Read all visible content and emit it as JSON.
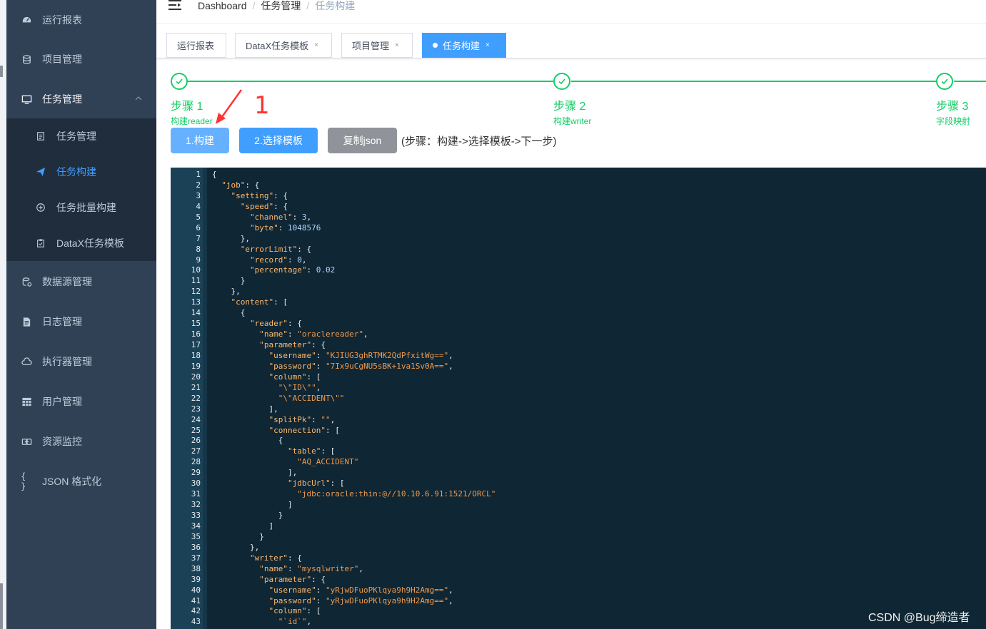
{
  "sidebar": {
    "items": [
      {
        "label": "运行报表",
        "icon": "dashboard-icon"
      },
      {
        "label": "项目管理",
        "icon": "database-icon"
      },
      {
        "label": "任务管理",
        "icon": "monitor-icon"
      },
      {
        "label": "数据源管理",
        "icon": "datasource-icon"
      },
      {
        "label": "日志管理",
        "icon": "document-icon"
      },
      {
        "label": "执行器管理",
        "icon": "cloud-icon"
      },
      {
        "label": "用户管理",
        "icon": "table-icon"
      },
      {
        "label": "资源监控",
        "icon": "monitor-link-icon"
      },
      {
        "label": "JSON 格式化",
        "icon": "braces-icon"
      }
    ],
    "submenu": [
      {
        "label": "任务管理",
        "icon": "task-list-icon"
      },
      {
        "label": "任务构建",
        "icon": "paper-plane-icon"
      },
      {
        "label": "任务批量构建",
        "icon": "batch-icon"
      },
      {
        "label": "DataX任务模板",
        "icon": "clipboard-icon"
      }
    ]
  },
  "navbar": {
    "breadcrumb": [
      "Dashboard",
      "任务管理",
      "任务构建"
    ]
  },
  "tags": [
    {
      "label": "运行报表",
      "closable": false
    },
    {
      "label": "DataX任务模板",
      "closable": true
    },
    {
      "label": "项目管理",
      "closable": true
    },
    {
      "label": "任务构建",
      "closable": true,
      "active": true
    }
  ],
  "tag_close": "×",
  "steps": [
    {
      "title": "步骤 1",
      "desc": "构建reader"
    },
    {
      "title": "步骤 2",
      "desc": "构建writer"
    },
    {
      "title": "步骤 3",
      "desc": "字段映射"
    }
  ],
  "annotation": {
    "number": "1"
  },
  "buttons": {
    "build": "1.构建",
    "template": "2.选择模板",
    "copy": "复制json"
  },
  "hint": "(步骤：构建->选择模板->下一步)",
  "code_lines": [
    "{",
    "  \"job\": {",
    "    \"setting\": {",
    "      \"speed\": {",
    "        \"channel\": 3,",
    "        \"byte\": 1048576",
    "      },",
    "      \"errorLimit\": {",
    "        \"record\": 0,",
    "        \"percentage\": 0.02",
    "      }",
    "    },",
    "    \"content\": [",
    "      {",
    "        \"reader\": {",
    "          \"name\": \"oraclereader\",",
    "          \"parameter\": {",
    "            \"username\": \"KJIUG3ghRTMK2QdPfxitWg==\",",
    "            \"password\": \"7Ix9uCgNU5sBK+1va1Sv0A==\",",
    "            \"column\": [",
    "              \"\\\"ID\\\"\",",
    "              \"\\\"ACCIDENT\\\"\"",
    "            ],",
    "            \"splitPk\": \"\",",
    "            \"connection\": [",
    "              {",
    "                \"table\": [",
    "                  \"AQ_ACCIDENT\"",
    "                ],",
    "                \"jdbcUrl\": [",
    "                  \"jdbc:oracle:thin:@//10.10.6.91:1521/ORCL\"",
    "                ]",
    "              }",
    "            ]",
    "          }",
    "        },",
    "        \"writer\": {",
    "          \"name\": \"mysqlwriter\",",
    "          \"parameter\": {",
    "            \"username\": \"yRjwDFuoPKlqya9h9H2Amg==\",",
    "            \"password\": \"yRjwDFuoPKlqya9h9H2Amg==\",",
    "            \"column\": [",
    "              \"`id`\","
  ],
  "watermark": "CSDN @Bug缔造者",
  "colors": {
    "sidebar_bg": "#304156",
    "submenu_bg": "#1f2d3d",
    "primary": "#409eff",
    "success": "#13ce66",
    "editor_bg": "#0f2634"
  }
}
